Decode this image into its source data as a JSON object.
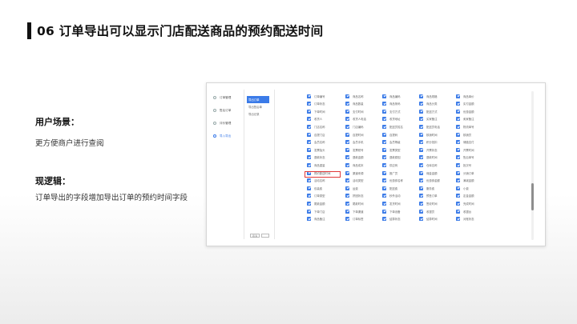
{
  "title": "06 订单导出可以显示门店配送商品的预约配送时间",
  "scenario": {
    "heading": "用户场景：",
    "text": "更方便商户进行查阅"
  },
  "logic": {
    "heading": "现逻辑：",
    "text": "订单导出的字段增加导出订单的预约时间字段"
  },
  "screenshot": {
    "nav_primary": [
      {
        "label": "订单管理",
        "active": false
      },
      {
        "label": "售后订单",
        "active": false
      },
      {
        "label": "评价管理",
        "active": false
      },
      {
        "label": "导入导出",
        "active": true
      }
    ],
    "nav_secondary": [
      {
        "label": "导出订单",
        "active": true
      },
      {
        "label": "导出售后单",
        "active": false
      },
      {
        "label": "导出记录",
        "active": false
      }
    ],
    "nav_secondary_button": "取消",
    "accent_color": "#3b7be8",
    "highlight_color": "#e03a3a",
    "fields": [
      [
        "订单编号",
        "商品名称",
        "商品编码",
        "商品规格",
        "商品单价"
      ],
      [
        "订单状态",
        "商品数量",
        "商品条码",
        "商品分类",
        "实付金额"
      ],
      [
        "下单时间",
        "支付时间",
        "支付方式",
        "配送方式",
        "优惠金额"
      ],
      [
        "收货人",
        "收货人电话",
        "收货地址",
        "买家备注",
        "卖家备注"
      ],
      [
        "门店名称",
        "门店编码",
        "配送员姓名",
        "配送员电话",
        "物流单号"
      ],
      [
        "自提门店",
        "自提时间",
        "自提码",
        "核销时间",
        "核销员"
      ],
      [
        "会员名称",
        "会员手机",
        "会员等级",
        "积分抵扣",
        "储值支付"
      ],
      [
        "发票抬头",
        "发票税号",
        "发票类型",
        "开票状态",
        "开票时间"
      ],
      [
        "退款状态",
        "退款金额",
        "退款原因",
        "退款时间",
        "售后单号"
      ],
      [
        "商品重量",
        "商品成本",
        "供应商",
        "仓库名称",
        "批次号"
      ],
      [
        "预约配送时间",
        "渠道来源",
        "推广员",
        "佣金金额",
        "分销订单"
      ],
      [
        "活动名称",
        "活动类型",
        "优惠券名称",
        "优惠券金额",
        "满减金额"
      ],
      [
        "包装费",
        "运费",
        "配送费",
        "服务费",
        "小费"
      ],
      [
        "订单类型",
        "拼团状态",
        "秒杀活动",
        "预售订单",
        "定金金额"
      ],
      [
        "尾款金额",
        "尾款时间",
        "发货时间",
        "签收时间",
        "完成时间"
      ],
      [
        "下单门店",
        "下单渠道",
        "下单设备",
        "收银员",
        "收银台"
      ],
      [
        "商品备注",
        "订单标签",
        "结算状态",
        "结算时间",
        "对账状态"
      ]
    ],
    "highlighted_field": "预约配送时间"
  }
}
